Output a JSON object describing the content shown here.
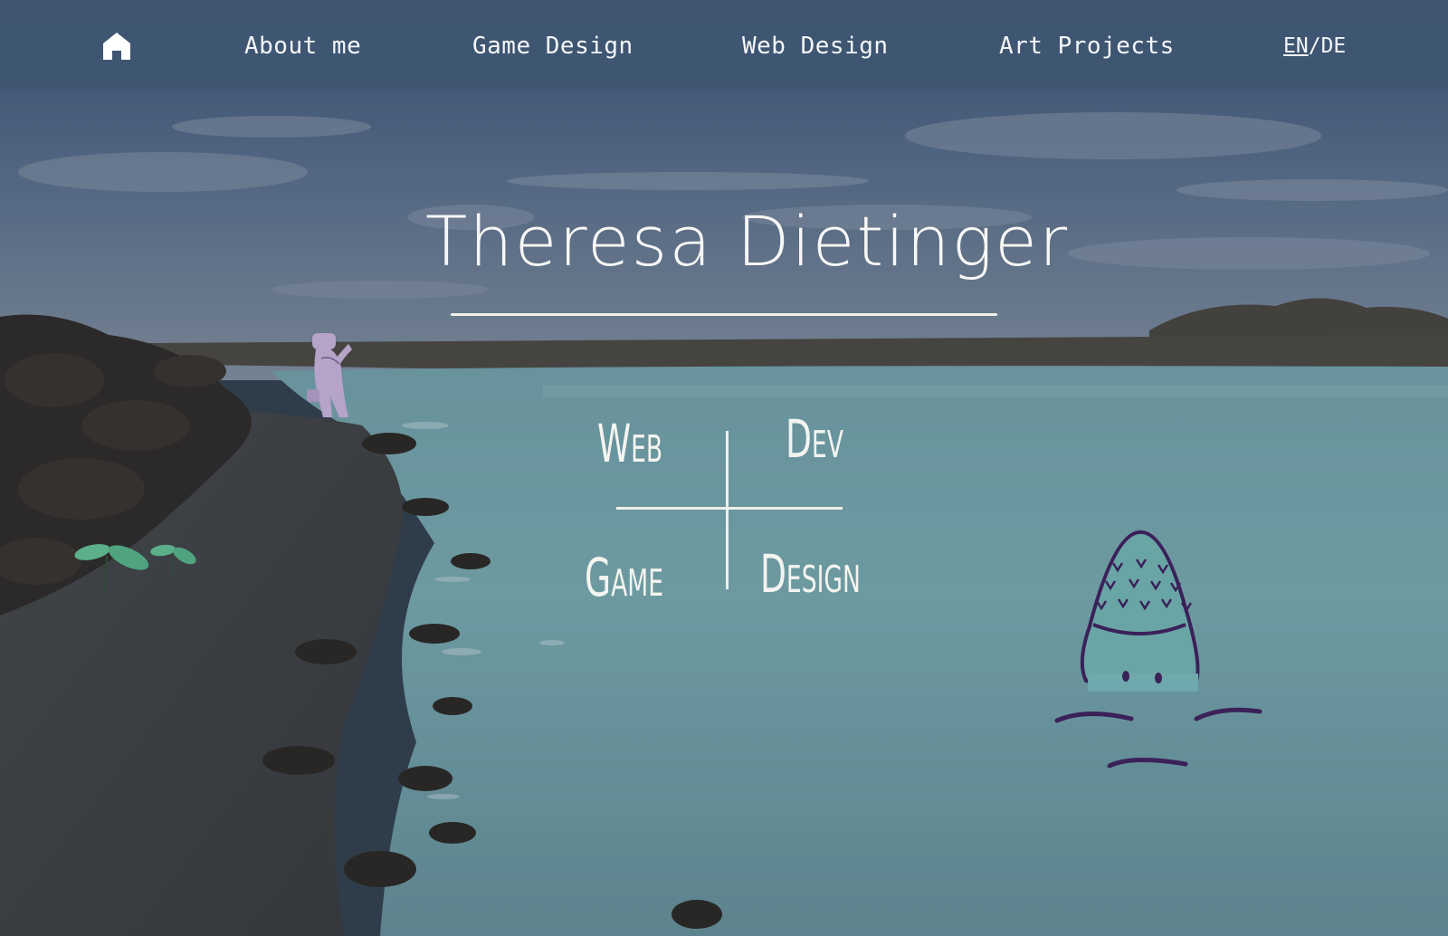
{
  "nav": {
    "home_icon": "home-icon",
    "items": [
      {
        "label": "About me"
      },
      {
        "label": "Game Design"
      },
      {
        "label": "Web Design"
      },
      {
        "label": "Art Projects"
      }
    ],
    "lang": {
      "en": "EN",
      "sep": "/",
      "de": "DE",
      "active": "EN"
    }
  },
  "hero": {
    "title": "Theresa Dietinger",
    "grid": {
      "top_left": "Web",
      "top_right": "Dev",
      "bottom_left": "Game",
      "bottom_right": "Design"
    }
  },
  "colors": {
    "nav_bg": "#405672",
    "nav_text": "#f4f6f8",
    "water": "#7fb6bd",
    "creature_fill": "#6aa5a6",
    "creature_outline": "#3b2159",
    "figure": "#b6a3c8",
    "sprout": "#5bb08a"
  }
}
